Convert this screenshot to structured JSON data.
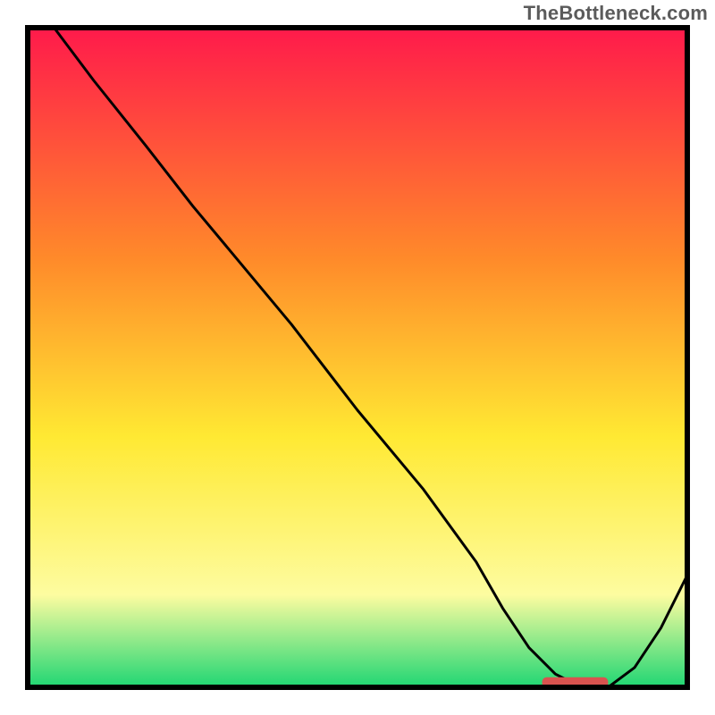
{
  "watermark": "TheBottleneck.com",
  "chart_data": {
    "type": "line",
    "title": "",
    "xlabel": "",
    "ylabel": "",
    "xlim": [
      0,
      100
    ],
    "ylim": [
      0,
      100
    ],
    "grid": false,
    "legend": false,
    "series": [
      {
        "name": "curve",
        "x": [
          4,
          10,
          18,
          25,
          30,
          40,
          50,
          60,
          68,
          72,
          76,
          80,
          84,
          88,
          92,
          96,
          100
        ],
        "y": [
          100,
          92,
          82,
          73,
          67,
          55,
          42,
          30,
          19,
          12,
          6,
          2,
          0,
          0,
          3,
          9,
          17
        ]
      }
    ],
    "annotations": [
      {
        "name": "bottleneck-marker",
        "type": "bar",
        "x_start": 78,
        "x_end": 88,
        "y": 0.7,
        "color": "#d9534f"
      }
    ],
    "background_gradient": {
      "top_color": "#ff1a4b",
      "mid_upper_color": "#ff8a2a",
      "mid_color": "#ffe933",
      "mid_lower_color": "#fdfca0",
      "bottom_color": "#1fd673"
    },
    "frame_color": "#000000",
    "line_color": "#000000",
    "line_width": 3
  }
}
